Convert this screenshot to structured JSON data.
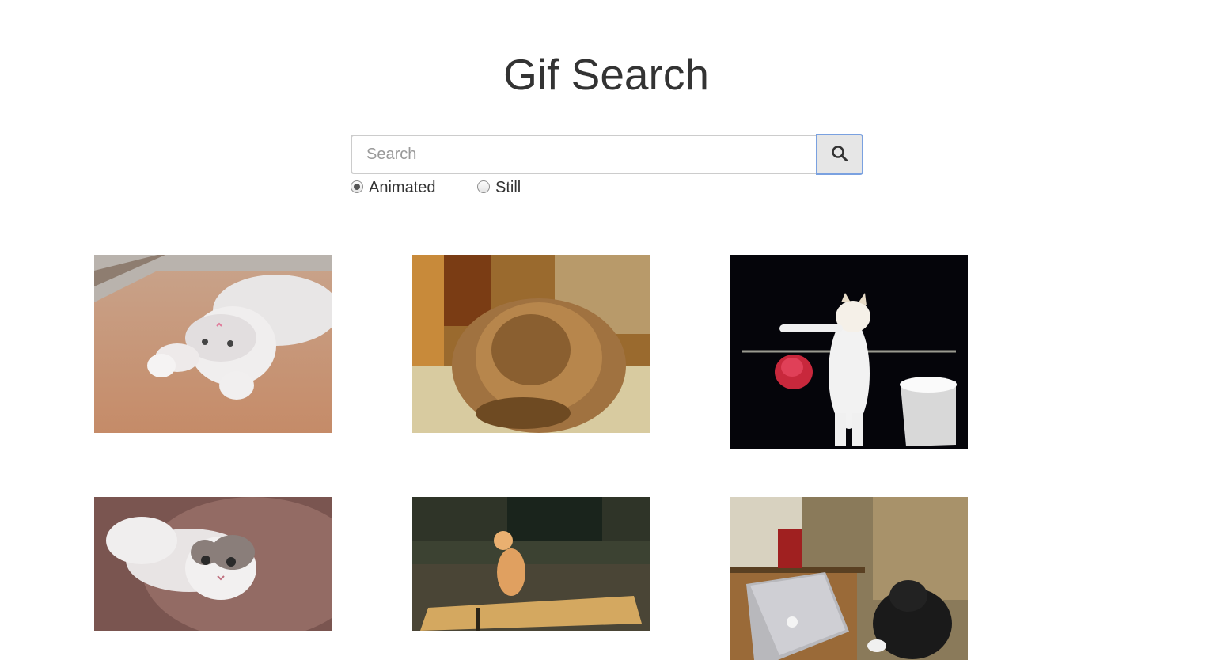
{
  "header": {
    "title": "Gif Search"
  },
  "search": {
    "placeholder": "Search",
    "value": "",
    "button_icon": "search-icon"
  },
  "mode": {
    "options": [
      {
        "label": "Animated",
        "selected": true
      },
      {
        "label": "Still",
        "selected": false
      }
    ]
  },
  "results": [
    {
      "subject": "white cat rolling on carpet"
    },
    {
      "subject": "fluffy orange kitten"
    },
    {
      "subject": "white cat on black background with red bra"
    },
    {
      "subject": "grey and white cat looking up"
    },
    {
      "subject": "orange cat standing on table"
    },
    {
      "subject": "black cat using laptop"
    }
  ]
}
